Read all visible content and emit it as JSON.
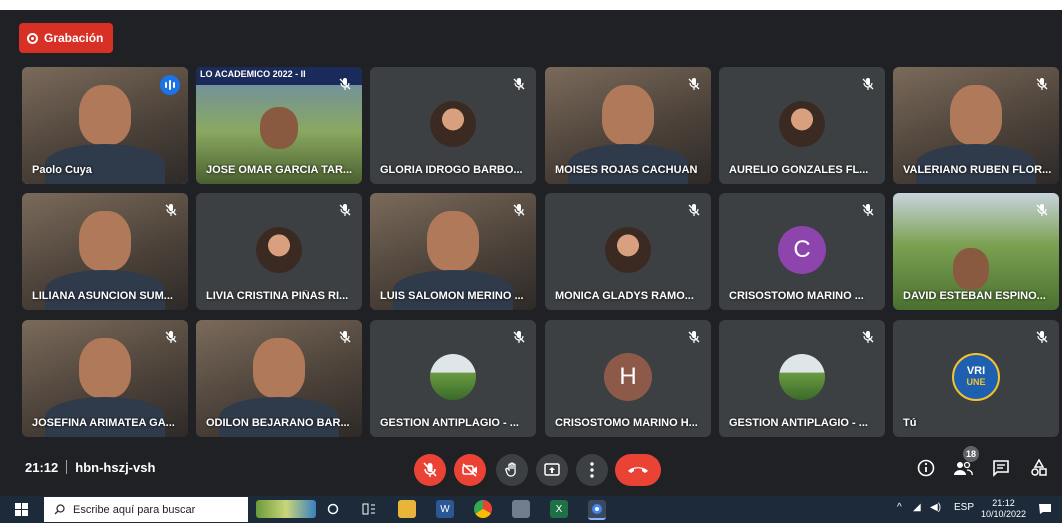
{
  "recording": {
    "label": "Grabación"
  },
  "tiles": [
    {
      "name": "Paolo Cuya",
      "speaking": true,
      "kind": "video-face"
    },
    {
      "name": "JOSE OMAR GARCIA TAR...",
      "kind": "video-banner",
      "banner": "LO ACADEMICO 2022 - II"
    },
    {
      "name": "GLORIA IDROGO BARBO...",
      "kind": "photo"
    },
    {
      "name": "MOISES ROJAS CACHUAN",
      "kind": "video-face"
    },
    {
      "name": "AURELIO GONZALES FL...",
      "kind": "photo"
    },
    {
      "name": "VALERIANO RUBEN FLOR...",
      "kind": "video-face"
    },
    {
      "name": "LILIANA ASUNCION SUM...",
      "kind": "video-face"
    },
    {
      "name": "LIVIA CRISTINA PIÑAS RI...",
      "kind": "photo"
    },
    {
      "name": "LUIS SALOMON MERINO ...",
      "kind": "video-face"
    },
    {
      "name": "MONICA GLADYS RAMO...",
      "kind": "photo"
    },
    {
      "name": "CRISOSTOMO MARINO ...",
      "kind": "letter",
      "letter": "C",
      "color": "#8e44ad"
    },
    {
      "name": "DAVID ESTEBAN ESPINO...",
      "kind": "video-campus"
    },
    {
      "name": "JOSEFINA ARIMATEA GA...",
      "kind": "video-face"
    },
    {
      "name": "ODILON BEJARANO BAR...",
      "kind": "video-face"
    },
    {
      "name": "GESTION ANTIPLAGIO - ...",
      "kind": "photo-campus"
    },
    {
      "name": "CRISOSTOMO MARINO H...",
      "kind": "letter",
      "letter": "H",
      "color": "#8d5a4a"
    },
    {
      "name": "GESTION ANTIPLAGIO - ...",
      "kind": "photo-campus"
    },
    {
      "name": "Tú",
      "kind": "logo",
      "logo_top": "VRI",
      "logo_bottom": "UNE"
    }
  ],
  "meeting": {
    "time": "21:12",
    "code": "hbn-hszj-vsh",
    "participants": "18"
  },
  "taskbar": {
    "search_placeholder": "Escribe aquí para buscar",
    "lang": "ESP",
    "clock_time": "21:12",
    "clock_date": "10/10/2022"
  },
  "colors": {
    "background": "#202124",
    "tile": "#3c4043",
    "red": "#ea4335",
    "accent": "#8ab4f8"
  }
}
